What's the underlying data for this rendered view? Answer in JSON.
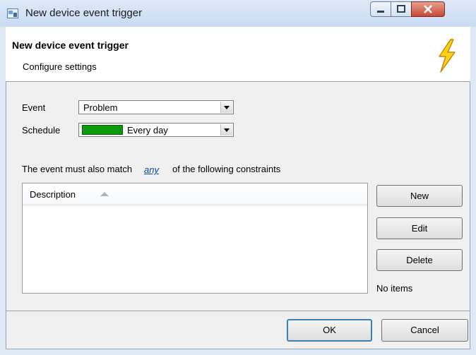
{
  "window": {
    "title": "New device event trigger",
    "controls": [
      "minimize-icon",
      "maximize-icon",
      "close-icon"
    ]
  },
  "header": {
    "title": "New device event trigger",
    "subtitle": "Configure settings",
    "icon": "lightning-bolt-icon"
  },
  "form": {
    "event_label": "Event",
    "event_value": "Problem",
    "schedule_label": "Schedule",
    "schedule_value": "Every day",
    "schedule_color": "#0c9a0c"
  },
  "constraints": {
    "text_before": "The event must also match",
    "link": "any",
    "text_after": "of the following constraints",
    "column_header": "Description",
    "items": [],
    "status": "No items"
  },
  "buttons": {
    "new": "New",
    "edit": "Edit",
    "delete": "Delete",
    "ok": "OK",
    "cancel": "Cancel"
  },
  "colors": {
    "link": "#0645ad",
    "accent_border": "#3c7fb1"
  }
}
